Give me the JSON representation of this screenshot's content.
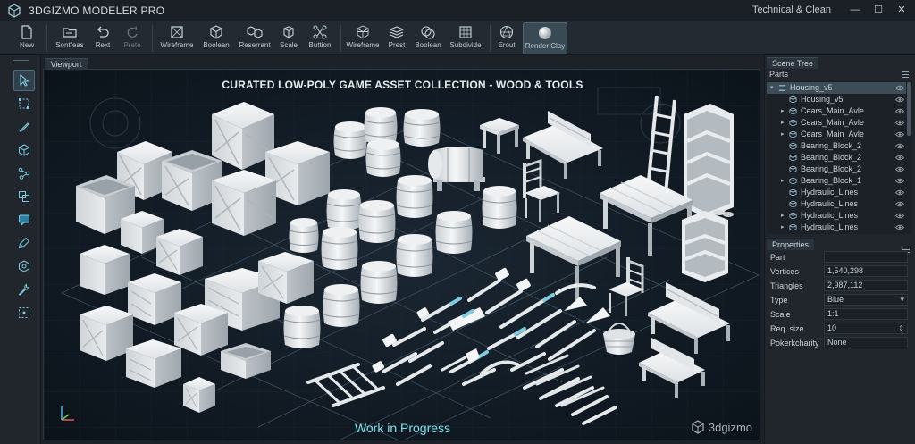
{
  "app": {
    "title": "3DGIZMO MODELER PRO",
    "preset": "Technical & Clean",
    "minimize": "—",
    "maximize": "☐",
    "close": "✕"
  },
  "toolbar": [
    {
      "label": "New",
      "icon": "new-file-icon",
      "enabled": true
    },
    {
      "label": "Sontfeas",
      "icon": "open-folder-icon",
      "enabled": true
    },
    {
      "label": "Rext",
      "icon": "undo-icon",
      "enabled": true
    },
    {
      "label": "Prete",
      "icon": "redo-icon",
      "enabled": false
    },
    {
      "label": "Wireframe",
      "icon": "wireframe-icon",
      "enabled": true
    },
    {
      "label": "Boolean",
      "icon": "cube-icon",
      "enabled": true
    },
    {
      "label": "Reserrant",
      "icon": "cubes-icon",
      "enabled": true
    },
    {
      "label": "Scale",
      "icon": "scale-icon",
      "enabled": true
    },
    {
      "label": "Buttion",
      "icon": "graph-icon",
      "enabled": true
    },
    {
      "label": "Wireframe",
      "icon": "wireframe-cube-icon",
      "enabled": true
    },
    {
      "label": "Prest",
      "icon": "layers-icon",
      "enabled": true
    },
    {
      "label": "Boolean",
      "icon": "boolean-spheres-icon",
      "enabled": true
    },
    {
      "label": "Subdivide",
      "icon": "subdivide-icon",
      "enabled": true
    },
    {
      "label": "Erout",
      "icon": "sphere-icon",
      "enabled": true
    },
    {
      "label": "Render Clay",
      "icon": "render-clay-icon",
      "enabled": true,
      "active": true
    }
  ],
  "lefttools": [
    "select-arrow-icon",
    "transform-icon",
    "pen-icon",
    "cube-icon",
    "node-icon",
    "copy-icon",
    "chat-icon",
    "brush-icon",
    "hexagon-icon",
    "wrench-icon",
    "measure-icon"
  ],
  "viewport": {
    "tab": "Viewport",
    "heading": "CURATED LOW-POLY GAME ASSET COLLECTION - WOOD & TOOLS",
    "status": "Work in Progress",
    "watermark": "3dgizmo"
  },
  "scene_tree": {
    "tab": "Scene Tree",
    "subhead": "Parts",
    "items": [
      {
        "name": "Housing_v5",
        "level": 0,
        "expandable": true,
        "expanded": true,
        "selected": true
      },
      {
        "name": "Housing_v5",
        "level": 1,
        "expandable": false
      },
      {
        "name": "Cears_Main_Avle",
        "level": 1,
        "expandable": true
      },
      {
        "name": "Cears_Main_Avle",
        "level": 1,
        "expandable": true
      },
      {
        "name": "Cears_Main_Avle",
        "level": 1,
        "expandable": true
      },
      {
        "name": "Bearing_Block_2",
        "level": 1,
        "expandable": false
      },
      {
        "name": "Bearing_Block_2",
        "level": 1,
        "expandable": false
      },
      {
        "name": "Bearing_Block_2",
        "level": 1,
        "expandable": false
      },
      {
        "name": "Bearing_Block_1",
        "level": 1,
        "expandable": true
      },
      {
        "name": "Hydraulic_Lines",
        "level": 1,
        "expandable": false
      },
      {
        "name": "Hydraulic_Lines",
        "level": 1,
        "expandable": false
      },
      {
        "name": "Hydraulic_Lines",
        "level": 1,
        "expandable": true
      },
      {
        "name": "Hydraulic_Lines",
        "level": 1,
        "expandable": true
      }
    ]
  },
  "properties": {
    "tab": "Properties",
    "rows": [
      {
        "key": "Part",
        "value": "",
        "kind": "text"
      },
      {
        "key": "Vertices",
        "value": "1,540,298",
        "kind": "text"
      },
      {
        "key": "Triangles",
        "value": "2,987,112",
        "kind": "text"
      },
      {
        "key": "Type",
        "value": "Blue",
        "kind": "select"
      },
      {
        "key": "Scale",
        "value": "1:1",
        "kind": "text"
      },
      {
        "key": "Req. size",
        "value": "10",
        "kind": "spin"
      },
      {
        "key": "Pokerkcharity",
        "value": "None",
        "kind": "text"
      }
    ]
  },
  "colors": {
    "accent": "#7ee0ea",
    "panel": "#20262c",
    "viewport_bg": "#0e1620",
    "clay": "#e9ecee"
  }
}
